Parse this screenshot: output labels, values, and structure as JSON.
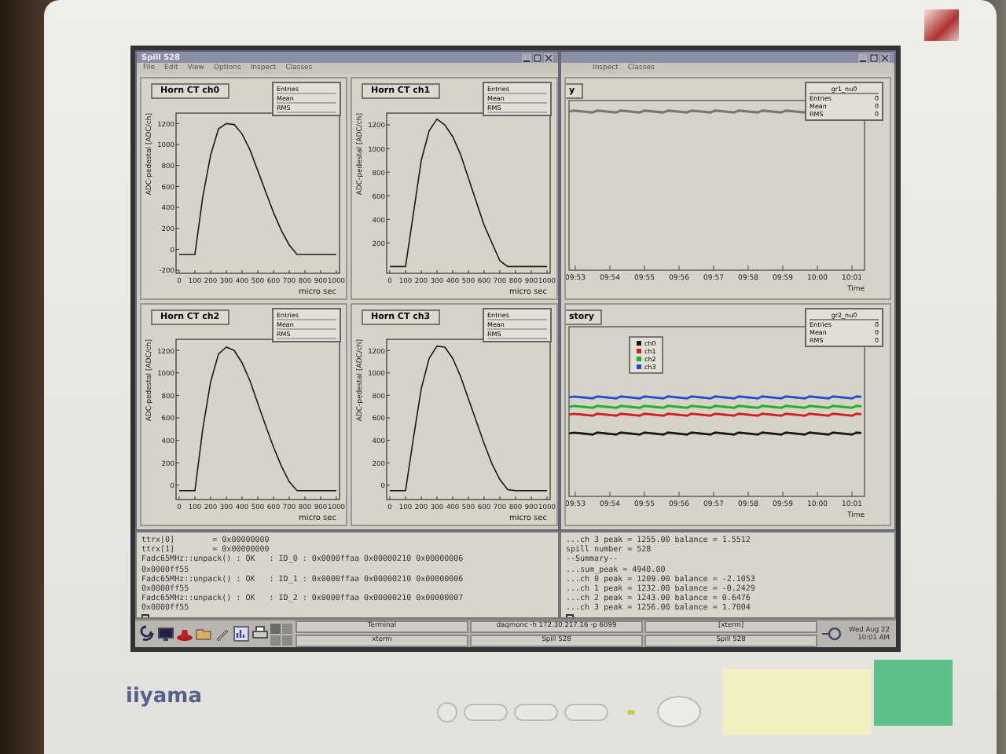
{
  "window_main": {
    "title": "Spill 528",
    "menu": [
      "File",
      "Edit",
      "View",
      "Options",
      "Inspect",
      "Classes"
    ],
    "pads": [
      {
        "stats": [
          {
            "label": "Entries"
          },
          {
            "label": "Mean"
          },
          {
            "label": "RMS"
          }
        ],
        "chart_data": {
          "type": "line",
          "title": "Horn CT ch0",
          "xlabel": "micro sec",
          "ylabel": "ADC-pedestal [ADC/ch]",
          "x": [
            0,
            50,
            100,
            150,
            200,
            250,
            300,
            350,
            400,
            450,
            500,
            550,
            600,
            650,
            700,
            750,
            800,
            900,
            1000
          ],
          "series": [
            {
              "color": "#1a1a1a",
              "values": [
                -50,
                -50,
                -50,
                500,
                900,
                1150,
                1200,
                1190,
                1100,
                950,
                750,
                550,
                350,
                180,
                40,
                -50,
                -50,
                -50,
                -50
              ]
            }
          ],
          "xlim": [
            0,
            1000
          ],
          "ylim": [
            -200,
            1300
          ],
          "xticks": [
            0,
            100,
            200,
            300,
            400,
            500,
            600,
            700,
            800,
            900,
            1000
          ],
          "yticks": [
            -200,
            0,
            200,
            400,
            600,
            800,
            1000,
            1200
          ]
        }
      },
      {
        "stats": [
          {
            "label": "Entries"
          },
          {
            "label": "Mean"
          },
          {
            "label": "RMS"
          }
        ],
        "chart_data": {
          "type": "line",
          "title": "Horn CT ch1",
          "xlabel": "micro sec",
          "ylabel": "ADC-pedestal [ADC/ch]",
          "x": [
            0,
            50,
            100,
            150,
            200,
            250,
            300,
            350,
            400,
            450,
            500,
            550,
            600,
            650,
            700,
            750,
            800,
            900,
            1000
          ],
          "series": [
            {
              "color": "#1a1a1a",
              "values": [
                0,
                0,
                0,
                450,
                900,
                1150,
                1250,
                1200,
                1100,
                950,
                750,
                550,
                350,
                200,
                50,
                0,
                0,
                0,
                0
              ]
            }
          ],
          "xlim": [
            0,
            1000
          ],
          "ylim": [
            -30,
            1300
          ],
          "xticks": [
            0,
            100,
            200,
            300,
            400,
            500,
            600,
            700,
            800,
            900,
            1000
          ],
          "yticks": [
            200,
            400,
            600,
            800,
            1000,
            1200
          ]
        }
      },
      {
        "stats": [
          {
            "label": "Entries"
          },
          {
            "label": "Mean"
          },
          {
            "label": "RMS"
          }
        ],
        "chart_data": {
          "type": "line",
          "title": "Horn CT ch2",
          "xlabel": "micro sec",
          "ylabel": "ADC-pedestal [ADC/ch]",
          "x": [
            0,
            50,
            100,
            150,
            200,
            250,
            300,
            350,
            400,
            450,
            500,
            550,
            600,
            650,
            700,
            750,
            800,
            900,
            1000
          ],
          "series": [
            {
              "color": "#1a1a1a",
              "values": [
                -50,
                -50,
                -50,
                500,
                920,
                1170,
                1230,
                1200,
                1090,
                930,
                730,
                530,
                340,
                170,
                30,
                -50,
                -50,
                -50,
                -50
              ]
            }
          ],
          "xlim": [
            0,
            1000
          ],
          "ylim": [
            -100,
            1300
          ],
          "xticks": [
            0,
            100,
            200,
            300,
            400,
            500,
            600,
            700,
            800,
            900,
            1000
          ],
          "yticks": [
            0,
            200,
            400,
            600,
            800,
            1000,
            1200
          ]
        }
      },
      {
        "stats": [
          {
            "label": "Entries"
          },
          {
            "label": "Mean"
          },
          {
            "label": "RMS"
          }
        ],
        "chart_data": {
          "type": "line",
          "title": "Horn CT ch3",
          "xlabel": "micro sec",
          "ylabel": "ADC-pedestal [ADC/ch]",
          "x": [
            0,
            50,
            100,
            150,
            200,
            250,
            300,
            350,
            400,
            450,
            500,
            550,
            600,
            650,
            700,
            750,
            800,
            900,
            1000
          ],
          "series": [
            {
              "color": "#1a1a1a",
              "values": [
                -50,
                -50,
                -50,
                420,
                860,
                1130,
                1240,
                1230,
                1130,
                970,
                770,
                570,
                370,
                190,
                50,
                -40,
                -50,
                -50,
                -50
              ]
            }
          ],
          "xlim": [
            0,
            1000
          ],
          "ylim": [
            -100,
            1300
          ],
          "xticks": [
            0,
            100,
            200,
            300,
            400,
            500,
            600,
            700,
            800,
            900,
            1000
          ],
          "yticks": [
            0,
            200,
            400,
            600,
            800,
            1000,
            1200
          ]
        }
      }
    ]
  },
  "window_history": {
    "menu": [
      "Inspect",
      "Classes"
    ],
    "pads": [
      {
        "title": "y",
        "stats_title": "gr1_nu0",
        "stats": [
          {
            "label": "Entries",
            "value": "0"
          },
          {
            "label": "Mean",
            "value": "0"
          },
          {
            "label": "RMS",
            "value": "0"
          }
        ],
        "x_labels": [
          "09:53",
          "09:54",
          "09:55",
          "09:56",
          "09:57",
          "09:58",
          "09:59",
          "10:00",
          "10:01"
        ],
        "xlabel": "Time"
      },
      {
        "title": "story",
        "stats_title": "gr2_nu0",
        "stats": [
          {
            "label": "Entries",
            "value": "0"
          },
          {
            "label": "Mean",
            "value": "0"
          },
          {
            "label": "RMS",
            "value": "0"
          }
        ],
        "x_labels": [
          "09:53",
          "09:54",
          "09:55",
          "09:56",
          "09:57",
          "09:58",
          "09:59",
          "10:00",
          "10:01"
        ],
        "xlabel": "Time",
        "legend": [
          {
            "label": "ch0",
            "color": "#1a1a1a"
          },
          {
            "label": "ch1",
            "color": "#d02020"
          },
          {
            "label": "ch2",
            "color": "#20b020"
          },
          {
            "label": "ch3",
            "color": "#2050d0"
          }
        ]
      }
    ]
  },
  "terminals": [
    {
      "lines": [
        "ttrx[0]        = 0x00000000",
        "ttrx[1]        = 0x00000000",
        "Fadc65MHz::unpack() : OK   : ID_0 : 0x0000ffaa 0x00000210 0x00000006",
        "0x0000ff55",
        "Fadc65MHz::unpack() : OK   : ID_1 : 0x0000ffaa 0x00000210 0x00000006",
        "0x0000ff55",
        "Fadc65MHz::unpack() : OK   : ID_2 : 0x0000ffaa 0x00000210 0x00000007",
        "0x0000ff55"
      ]
    },
    {
      "lines": [
        "...ch 3 peak = 1255.00 balance = 1.5512",
        "spill number = 528",
        "--Summary--",
        "...sum_peak = 4940.00",
        "...ch 0 peak = 1209.00 balance = -2.1053",
        "...ch 1 peak = 1232.00 balance = -0.2429",
        "...ch 2 peak = 1243.00 balance = 0.6476",
        "...ch 3 peak = 1256.00 balance = 1.7004"
      ]
    }
  ],
  "taskbar": {
    "tasks": [
      {
        "label": "Terminal"
      },
      {
        "label": "xterm"
      },
      {
        "label": "daqmonc -h 172.30.217.16 -p 6099"
      },
      {
        "label": "Spill 528"
      },
      {
        "label": "[xterm]"
      },
      {
        "label": "Spill 528"
      }
    ],
    "clock": {
      "date": "Wed Aug 22",
      "time": "10:01 AM"
    }
  },
  "monitor": {
    "brand": "iiyama"
  }
}
